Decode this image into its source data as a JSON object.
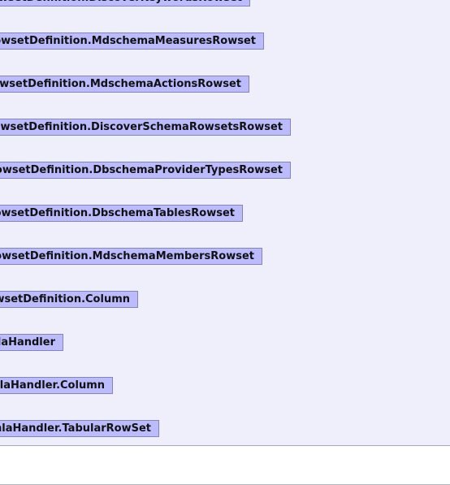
{
  "diagram": {
    "nodes": [
      {
        "label": "RowsetDefinition.DiscoverKeywordsRowset"
      },
      {
        "label": "RowsetDefinition.MdschemaMeasuresRowset"
      },
      {
        "label": "RowsetDefinition.MdschemaActionsRowset"
      },
      {
        "label": "RowsetDefinition.DiscoverSchemaRowsetsRowset"
      },
      {
        "label": "RowsetDefinition.DbschemaProviderTypesRowset"
      },
      {
        "label": "RowsetDefinition.DbschemaTablesRowset"
      },
      {
        "label": "RowsetDefinition.MdschemaMembersRowset"
      },
      {
        "label": "RowsetDefinition.Column"
      },
      {
        "label": "XmlaHandler"
      },
      {
        "label": "XmlaHandler.Column"
      },
      {
        "label": "XmlaHandler.TabularRowSet"
      }
    ],
    "colors": {
      "background": "#efeffc",
      "node_fill": "#bbbbfd",
      "node_border": "#8484bc"
    }
  }
}
